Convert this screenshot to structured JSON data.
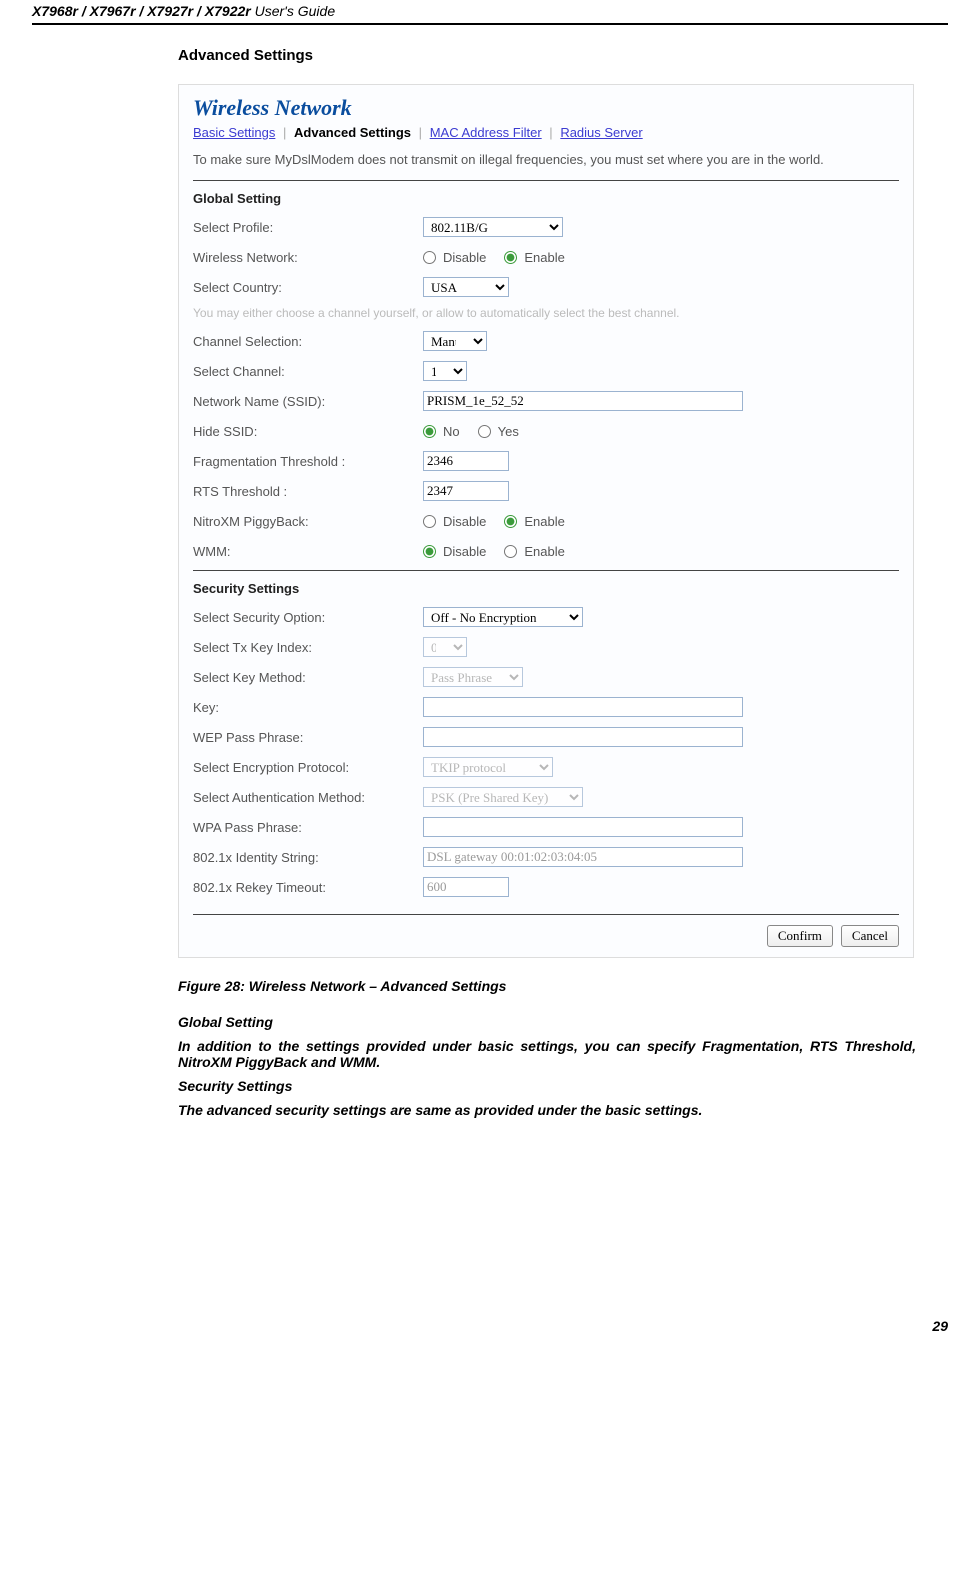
{
  "header": {
    "models": "X7968r / X7967r / X7927r / X7922r",
    "suffix": " User's Guide"
  },
  "section_heading": "Advanced Settings",
  "panel": {
    "title": "Wireless Network",
    "tabs": {
      "basic": "Basic Settings",
      "advanced": "Advanced Settings",
      "mac": "MAC Address Filter",
      "radius": "Radius Server"
    },
    "intro": "To make sure MyDslModem does not transmit on illegal frequencies, you must set where you are in the world.",
    "global": {
      "heading": "Global Setting",
      "labels": {
        "profile": "Select Profile:",
        "wireless": "Wireless Network:",
        "country": "Select Country:",
        "help": "You may either choose a channel yourself, or allow to automatically select the best channel.",
        "chan_sel": "Channel Selection:",
        "sel_chan": "Select Channel:",
        "ssid": "Network Name (SSID):",
        "hide": "Hide SSID:",
        "frag": "Fragmentation Threshold :",
        "rts": "RTS Threshold :",
        "nitro": "NitroXM PiggyBack:",
        "wmm": "WMM:"
      },
      "values": {
        "profile": "802.11B/G",
        "country": "USA",
        "chan_sel": "Manual",
        "sel_chan": "1",
        "ssid": "PRISM_1e_52_52",
        "frag": "2346",
        "rts": "2347"
      },
      "radios": {
        "disable": "Disable",
        "enable": "Enable",
        "no": "No",
        "yes": "Yes"
      }
    },
    "security": {
      "heading": "Security Settings",
      "labels": {
        "opt": "Select Security Option:",
        "tx": "Select Tx Key Index:",
        "method": "Select Key Method:",
        "key": "Key:",
        "wep": "WEP Pass Phrase:",
        "enc": "Select Encryption Protocol:",
        "auth": "Select Authentication Method:",
        "wpa": "WPA Pass Phrase:",
        "idstr": "802.1x Identity String:",
        "rekey": "802.1x Rekey Timeout:"
      },
      "values": {
        "opt": "Off - No Encryption",
        "tx": "0",
        "method": "Pass Phrase",
        "enc": "TKIP protocol",
        "auth": "PSK (Pre Shared Key)",
        "idstr": "DSL gateway 00:01:02:03:04:05",
        "rekey": "600"
      }
    },
    "buttons": {
      "confirm": "Confirm",
      "cancel": "Cancel"
    }
  },
  "caption": "Figure 28: Wireless Network – Advanced Settings",
  "body": {
    "gs_head": "Global Setting",
    "gs_text": "In addition to the settings provided under basic settings, you can specify Fragmentation, RTS Threshold, NitroXM PiggyBack and WMM.",
    "ss_head": "Security Settings",
    "ss_text": "The advanced security settings are same as provided under the basic settings."
  },
  "page_number": "29"
}
